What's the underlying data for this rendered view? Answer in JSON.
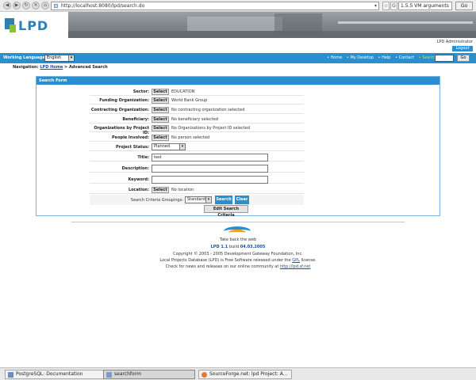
{
  "browser": {
    "url": "http://localhost:8080/lpd/search.do",
    "search_value": "1.5.5 VM arguments",
    "go_label": "Go",
    "dropdown_arrow": "▾"
  },
  "header": {
    "logo_text": "LPD",
    "admin_label": "LPD Administrator",
    "logout_label": "Logout"
  },
  "menubar": {
    "language_label": "Working Language :",
    "language_value": "English",
    "links": [
      "• Home",
      "• My Desktop",
      "• Help",
      "• Contact",
      "• Search"
    ],
    "go_label": "Go",
    "colors": {
      "bar": "#2a8fcf",
      "highlight": "#b9f23c"
    }
  },
  "breadcrumb": {
    "prefix": "Navigation:",
    "home": "LPD Home",
    "separator": " > ",
    "current": "Advanced Search"
  },
  "form": {
    "title": "Search Form",
    "select_label": "Select",
    "rows": [
      {
        "label": "Sector:",
        "value": "EDUCATION"
      },
      {
        "label": "Funding Organization:",
        "value": "World Bank Group"
      },
      {
        "label": "Contracting Organization:",
        "value": "No contracting organization selected"
      },
      {
        "label": "Beneficiary:",
        "value": "No beneficiary selected"
      },
      {
        "label": "Organizations by Project ID:",
        "value": "No Organizations by Project ID selected"
      },
      {
        "label": "People Involved:",
        "value": "No person selected"
      }
    ],
    "project_status": {
      "label": "Project Status:",
      "value": "Planned"
    },
    "title_field": {
      "label": "Title:",
      "value": "test"
    },
    "description_field": {
      "label": "Description:",
      "value": ""
    },
    "keyword_field": {
      "label": "Keyword:",
      "value": ""
    },
    "location": {
      "label": "Location:",
      "value": "No location"
    },
    "criteria": {
      "label": "Search Criteria Groupings:",
      "value": "Standard"
    },
    "search_label": "Search",
    "clear_label": "Clear",
    "edit_label": "Edit Search Criteria"
  },
  "footer": {
    "tagline": "Take back the web",
    "version_prefix": "LPD 1.1",
    "build_label": "build",
    "build_value": "04.03.2005",
    "copyright": "Copyright © 2003 - 2005 Development Gateway Foundation, Inc.",
    "license_pre": "Local Projects Database (LPD) is Free Software released under the",
    "license_link": "GPL",
    "license_post": "license.",
    "news_pre": "Check for news and releases on our online community at",
    "news_link": "http://lpd.sf.net"
  },
  "taskbar": {
    "items": [
      "PostgreSQL: Documentation",
      "searchform",
      "SourceForge.net: lpd Project: A..."
    ]
  }
}
